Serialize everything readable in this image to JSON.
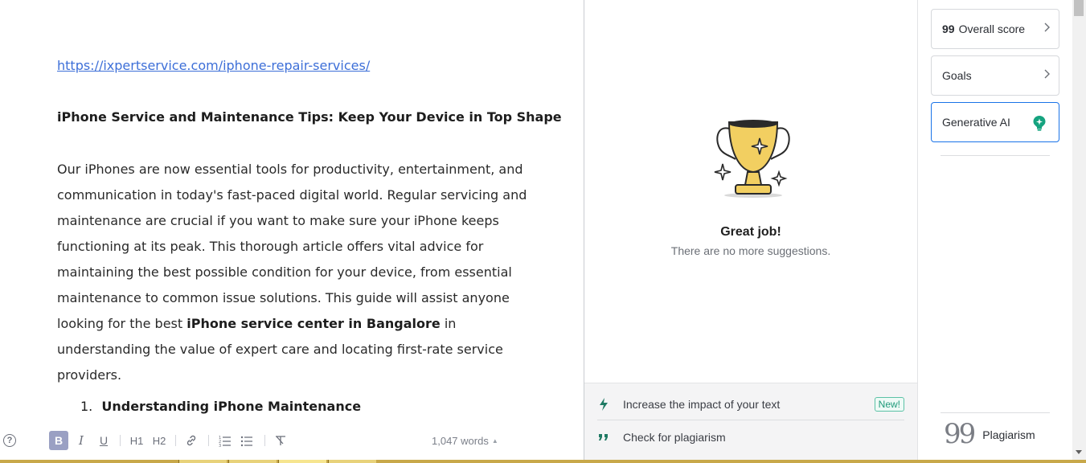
{
  "editor": {
    "link": "https://ixpertservice.com/iphone-repair-services/",
    "heading": "iPhone Service and Maintenance Tips: Keep Your Device in Top Shape",
    "paragraph_part1": "Our iPhones are now essential tools for productivity, entertainment, and communication in today's fast-paced digital world. Regular servicing and maintenance are crucial if you want to make sure your iPhone keeps functioning at its peak. This thorough article offers vital advice for maintaining the best possible condition for your device, from essential maintenance to common issue solutions. This guide will assist anyone looking for the best ",
    "paragraph_bold": "iPhone service center in Bangalore",
    "paragraph_part2": " in understanding the value of expert care and locating first-rate service providers.",
    "list_item_number": "1.",
    "list_item_text": "Understanding iPhone Maintenance"
  },
  "toolbar": {
    "help": "?",
    "bold": "B",
    "italic": "I",
    "underline": "U",
    "h1": "H1",
    "h2": "H2",
    "word_count": "1,047 words",
    "word_count_caret": "▲"
  },
  "assistant": {
    "title": "Great job!",
    "subtitle": "There are no more suggestions.",
    "actions": [
      {
        "label": "Increase the impact of your text",
        "badge": "New!",
        "icon": "lightning-icon"
      },
      {
        "label": "Check for plagiarism",
        "icon": "quote-icon"
      }
    ]
  },
  "sidebar": {
    "overall_score_value": "99",
    "overall_score_label": "Overall score",
    "goals_label": "Goals",
    "generative_ai_label": "Generative AI",
    "plagiarism_label": "Plagiarism",
    "plagiarism_glyph": "99"
  },
  "colors": {
    "link": "#3d6fd8",
    "accent_green": "#15a37f",
    "active_border": "#1a73e8",
    "bold_button": "#9aa0c3"
  }
}
